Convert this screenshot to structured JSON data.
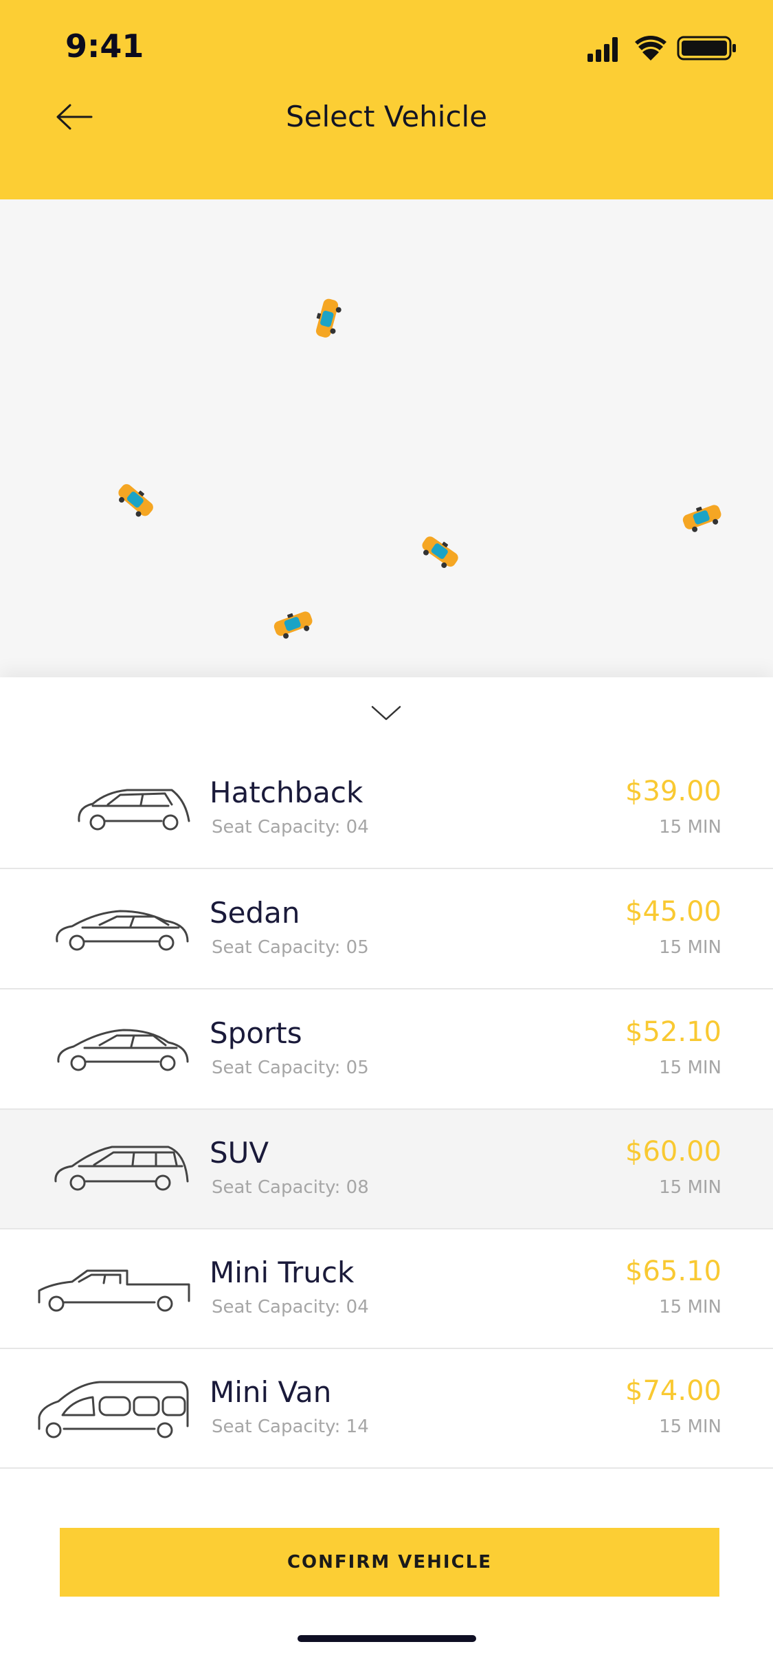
{
  "status_bar": {
    "time": "9:41"
  },
  "header": {
    "title": "Select Vehicle"
  },
  "vehicles": [
    {
      "name": "Hatchback",
      "capacity_label": "Seat Capacity:",
      "capacity": "04",
      "price": "$39.00",
      "eta": "15 MIN",
      "icon": "hatchback-icon",
      "selected": false
    },
    {
      "name": "Sedan",
      "capacity_label": "Seat Capacity:",
      "capacity": "05",
      "price": "$45.00",
      "eta": "15 MIN",
      "icon": "sedan-icon",
      "selected": false
    },
    {
      "name": "Sports",
      "capacity_label": "Seat Capacity:",
      "capacity": "05",
      "price": "$52.10",
      "eta": "15 MIN",
      "icon": "sports-car-icon",
      "selected": false
    },
    {
      "name": "SUV",
      "capacity_label": "Seat Capacity:",
      "capacity": "08",
      "price": "$60.00",
      "eta": "15 MIN",
      "icon": "suv-icon",
      "selected": true
    },
    {
      "name": "Mini Truck",
      "capacity_label": "Seat Capacity:",
      "capacity": "04",
      "price": "$65.10",
      "eta": "15 MIN",
      "icon": "mini-truck-icon",
      "selected": false
    },
    {
      "name": "Mini Van",
      "capacity_label": "Seat Capacity:",
      "capacity": "14",
      "price": "$74.00",
      "eta": "15 MIN",
      "icon": "mini-van-icon",
      "selected": false
    }
  ],
  "confirm_button": {
    "label": "CONFIRM VEHICLE"
  },
  "colors": {
    "accent": "#FCCE34",
    "price": "#F9C932",
    "title": "#1A1A3A",
    "muted": "#A6A6A6",
    "map_bg": "#F6F6F6",
    "selected_row": "#F4F4F4"
  },
  "icons": [
    "back-arrow-icon",
    "signal-icon",
    "wifi-icon",
    "battery-icon",
    "taxi-marker-icon",
    "chevron-down-icon"
  ]
}
